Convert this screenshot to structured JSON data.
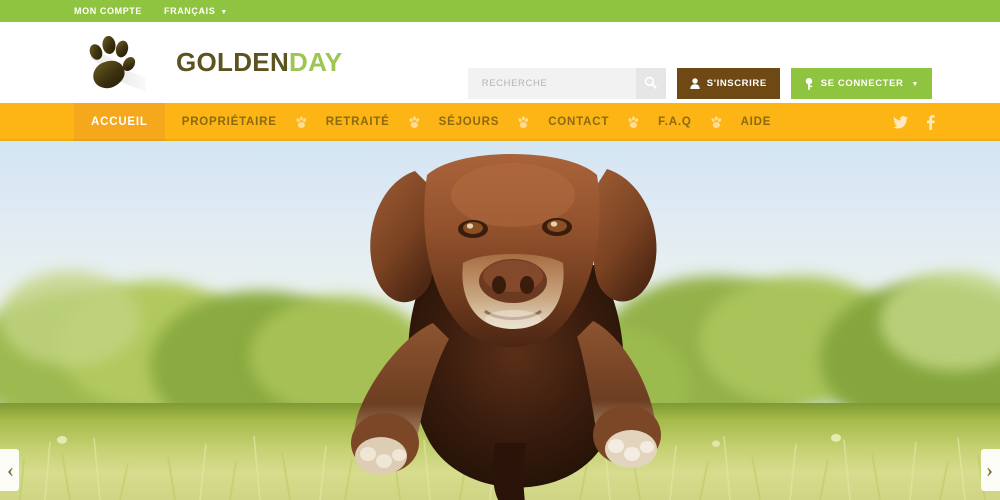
{
  "topbar": {
    "account_label": "MON COMPTE",
    "language_label": "FRANÇAIS",
    "caret": "▼",
    "background": "#8fc440"
  },
  "header": {
    "brand_first": "GOLDEN",
    "brand_second": "DAY",
    "brand_first_color": "#5d5320",
    "brand_second_color": "#9dc652",
    "logo_icon": "paw-print-icon",
    "search": {
      "placeholder": "RECHERCHE",
      "value": "",
      "button_icon": "search-icon"
    },
    "signup": {
      "label": "S'INSCRIRE",
      "icon": "user-icon",
      "color": "#6e4913"
    },
    "login": {
      "label": "SE CONNECTER",
      "icon": "key-icon",
      "caret": "▼",
      "color": "#8fc440"
    }
  },
  "nav": {
    "background": "#fcb515",
    "active_background": "#f5a81c",
    "separator_icon": "paw-separator-icon",
    "items": [
      {
        "label": "ACCUEIL",
        "active": true
      },
      {
        "label": "PROPRIÉTAIRE",
        "active": false
      },
      {
        "label": "RETRAITÉ",
        "active": false
      },
      {
        "label": "SÉJOURS",
        "active": false
      },
      {
        "label": "CONTACT",
        "active": false
      },
      {
        "label": "F.A.Q",
        "active": false
      },
      {
        "label": "AIDE",
        "active": false
      }
    ],
    "social": [
      {
        "name": "twitter-icon"
      },
      {
        "name": "facebook-icon"
      }
    ]
  },
  "hero": {
    "description": "Chocolate brown Labrador dog leaping toward the camera over a sunlit grass field with green trees and pale blue sky",
    "prev_arrow": "‹",
    "next_arrow": "›"
  }
}
